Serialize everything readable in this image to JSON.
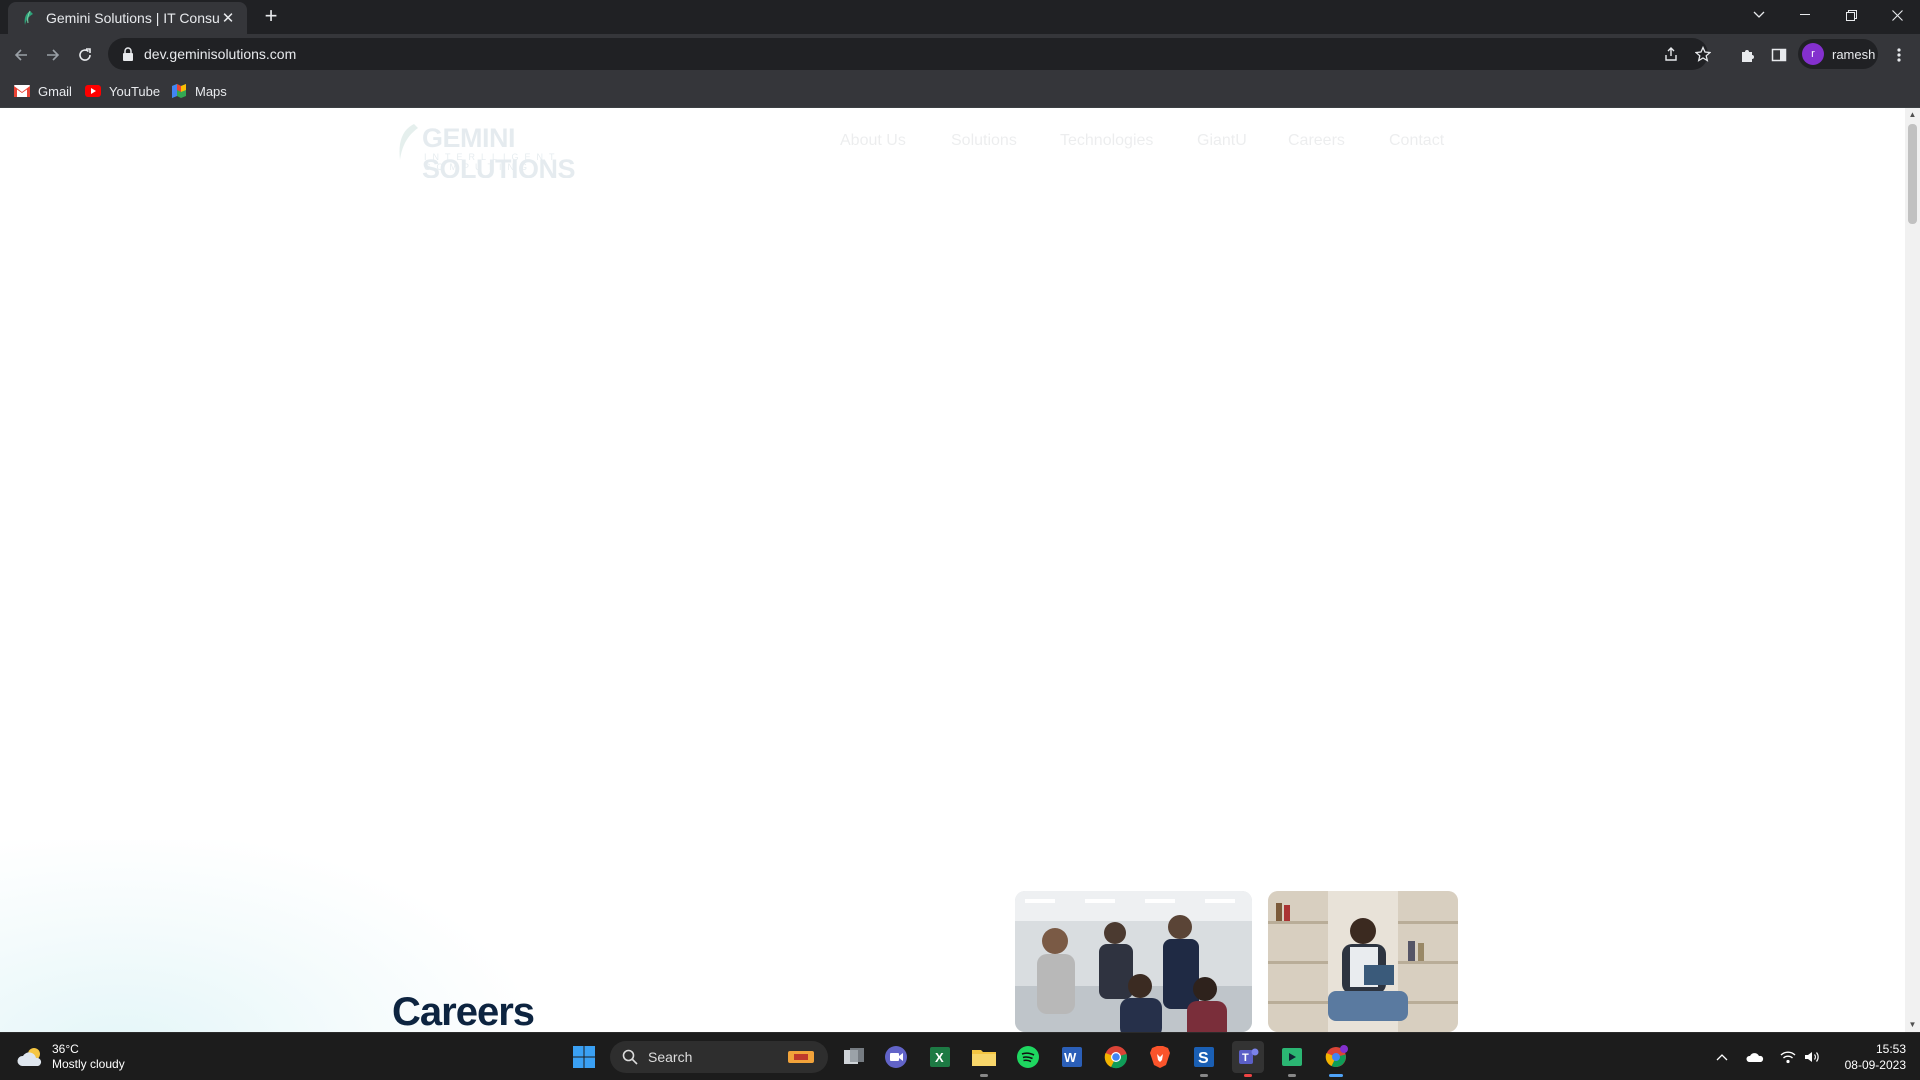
{
  "browser": {
    "tab_title": "Gemini Solutions | IT Consulting, ",
    "url": "dev.geminisolutions.com",
    "profile_initial": "r",
    "profile_name": "ramesh",
    "bookmarks": [
      "Gmail",
      "YouTube",
      "Maps"
    ]
  },
  "site": {
    "logo_name": "GEMINI SOLUTIONS",
    "logo_tagline": "INTERLLIGENT COMPUTING",
    "nav": [
      "About Us",
      "Solutions",
      "Technologies",
      "GiantU",
      "Careers",
      "Contact"
    ],
    "careers_heading": "Careers"
  },
  "taskbar": {
    "weather_temp": "36°C",
    "weather_desc": "Mostly cloudy",
    "search_label": "Search",
    "time": "15:53",
    "date": "08-09-2023"
  },
  "colors": {
    "chrome_dark": "#202124",
    "chrome_toolbar": "#35363a",
    "heading": "#0d2440",
    "taskbar": "#1c1c1c"
  }
}
